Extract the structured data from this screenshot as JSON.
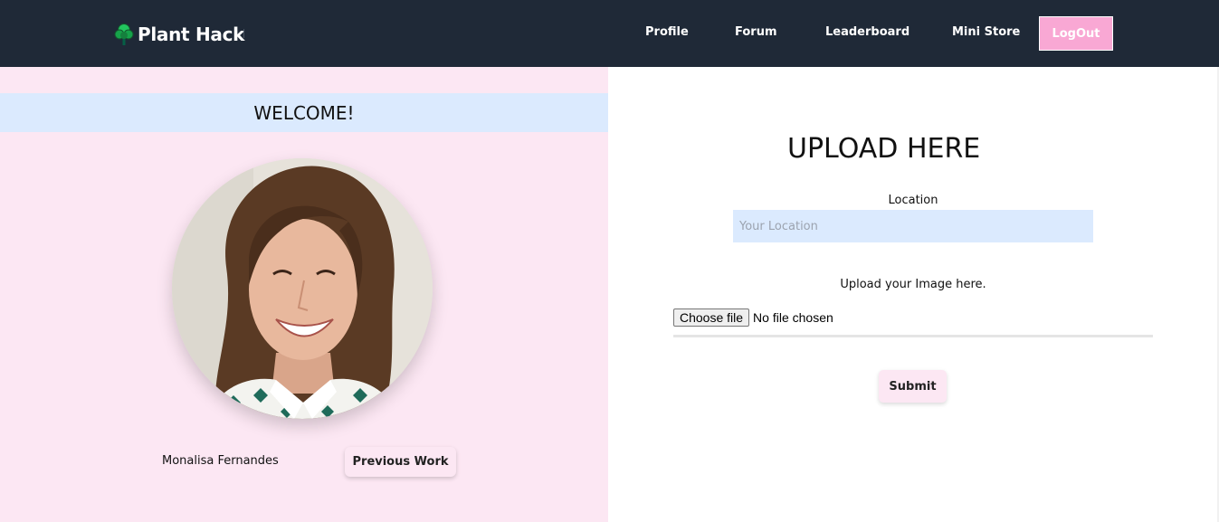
{
  "brand": {
    "name": "Plant Hack",
    "icon": "tree-icon"
  },
  "nav": {
    "links": [
      "Profile",
      "Forum",
      "Leaderboard",
      "Mini Store"
    ],
    "logout_label": "LogOut"
  },
  "profile": {
    "welcome": "WELCOME!",
    "name": "Monalisa Fernandes",
    "previous_work_label": "Previous Work"
  },
  "upload": {
    "title": "UPLOAD HERE",
    "location_label": "Location",
    "location_placeholder": "Your Location",
    "location_value": "",
    "image_label": "Upload your Image here.",
    "choose_file_label": "Choose file",
    "no_file_text": "No file chosen",
    "submit_label": "Submit"
  },
  "colors": {
    "nav_bg": "#1f2937",
    "accent_pink": "#f9a8d4",
    "panel_pink": "#fce7f3",
    "input_blue": "#dbeafe"
  }
}
